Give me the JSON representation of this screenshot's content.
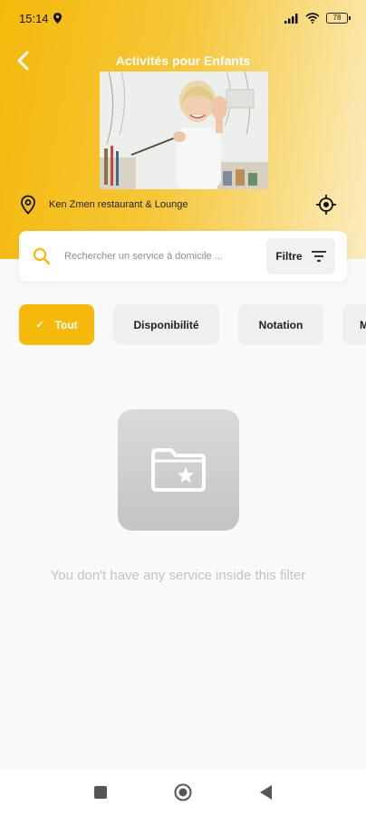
{
  "status_bar": {
    "time": "15:14",
    "battery": "78"
  },
  "header": {
    "title": "Activités pour Enfants"
  },
  "location": {
    "address": "Ken Zmen restaurant & Lounge"
  },
  "search": {
    "placeholder": "Rechercher un service à domicile ...",
    "value": "",
    "filter_label": "Filtre"
  },
  "filters": {
    "chips": [
      {
        "label": "Tout",
        "selected": true
      },
      {
        "label": "Disponibilité",
        "selected": false
      },
      {
        "label": "Notation",
        "selected": false
      },
      {
        "label": "M",
        "selected": false
      }
    ]
  },
  "empty_state": {
    "message": "You don't have any service inside this filter"
  },
  "colors": {
    "accent": "#f4b90a",
    "chip_bg": "#efefef",
    "empty_text": "#c4c4c4"
  },
  "icons": {
    "back": "chevron-left-icon",
    "location": "map-pin-icon",
    "gps": "crosshair-icon",
    "search": "search-icon",
    "filter": "filter-lines-icon",
    "check": "check-icon",
    "empty": "folder-star-icon",
    "nav": [
      "square-icon",
      "circle-icon",
      "triangle-back-icon"
    ]
  }
}
